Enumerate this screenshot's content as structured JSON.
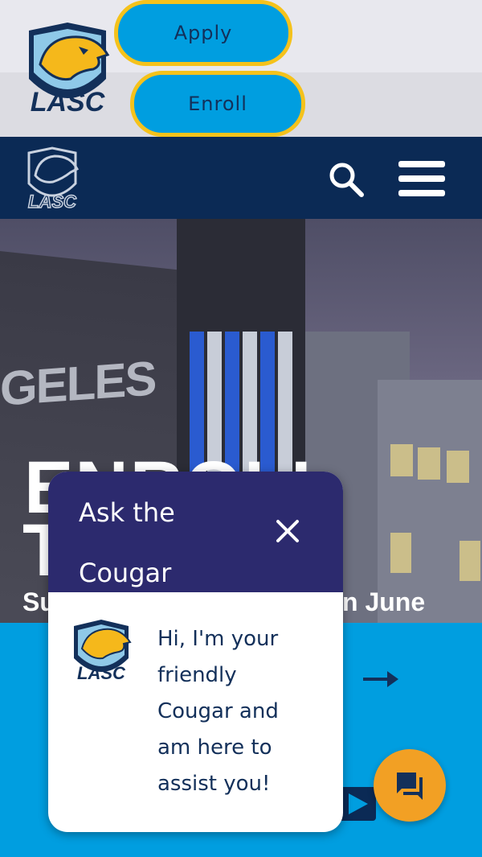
{
  "header": {
    "apply_label": "Apply",
    "enroll_label": "Enroll",
    "logo_text": "LASC"
  },
  "nav": {
    "search_icon": "search-icon",
    "menu_icon": "hamburger-menu-icon",
    "logo_text": "LASC"
  },
  "hero": {
    "building_sign": "GELES",
    "title_line1": "ENROLL",
    "title_line2": "T",
    "subtitle_start": "Su",
    "subtitle_end": "n June"
  },
  "content": {
    "link_text_fragment": "s",
    "arrow_icon": "arrow-right-icon",
    "play_icon": "play-icon"
  },
  "chat": {
    "title": "Ask the Cougar",
    "close_icon": "close-icon",
    "message": "Hi, I'm your friendly Cougar and am here to assist you!",
    "launcher_icon": "chat-bubble-icon"
  },
  "colors": {
    "brand_blue": "#009ee0",
    "navy": "#0b2a55",
    "gold": "#f5c21b",
    "chat_header": "#2c2a6e",
    "fab": "#f2a024"
  }
}
